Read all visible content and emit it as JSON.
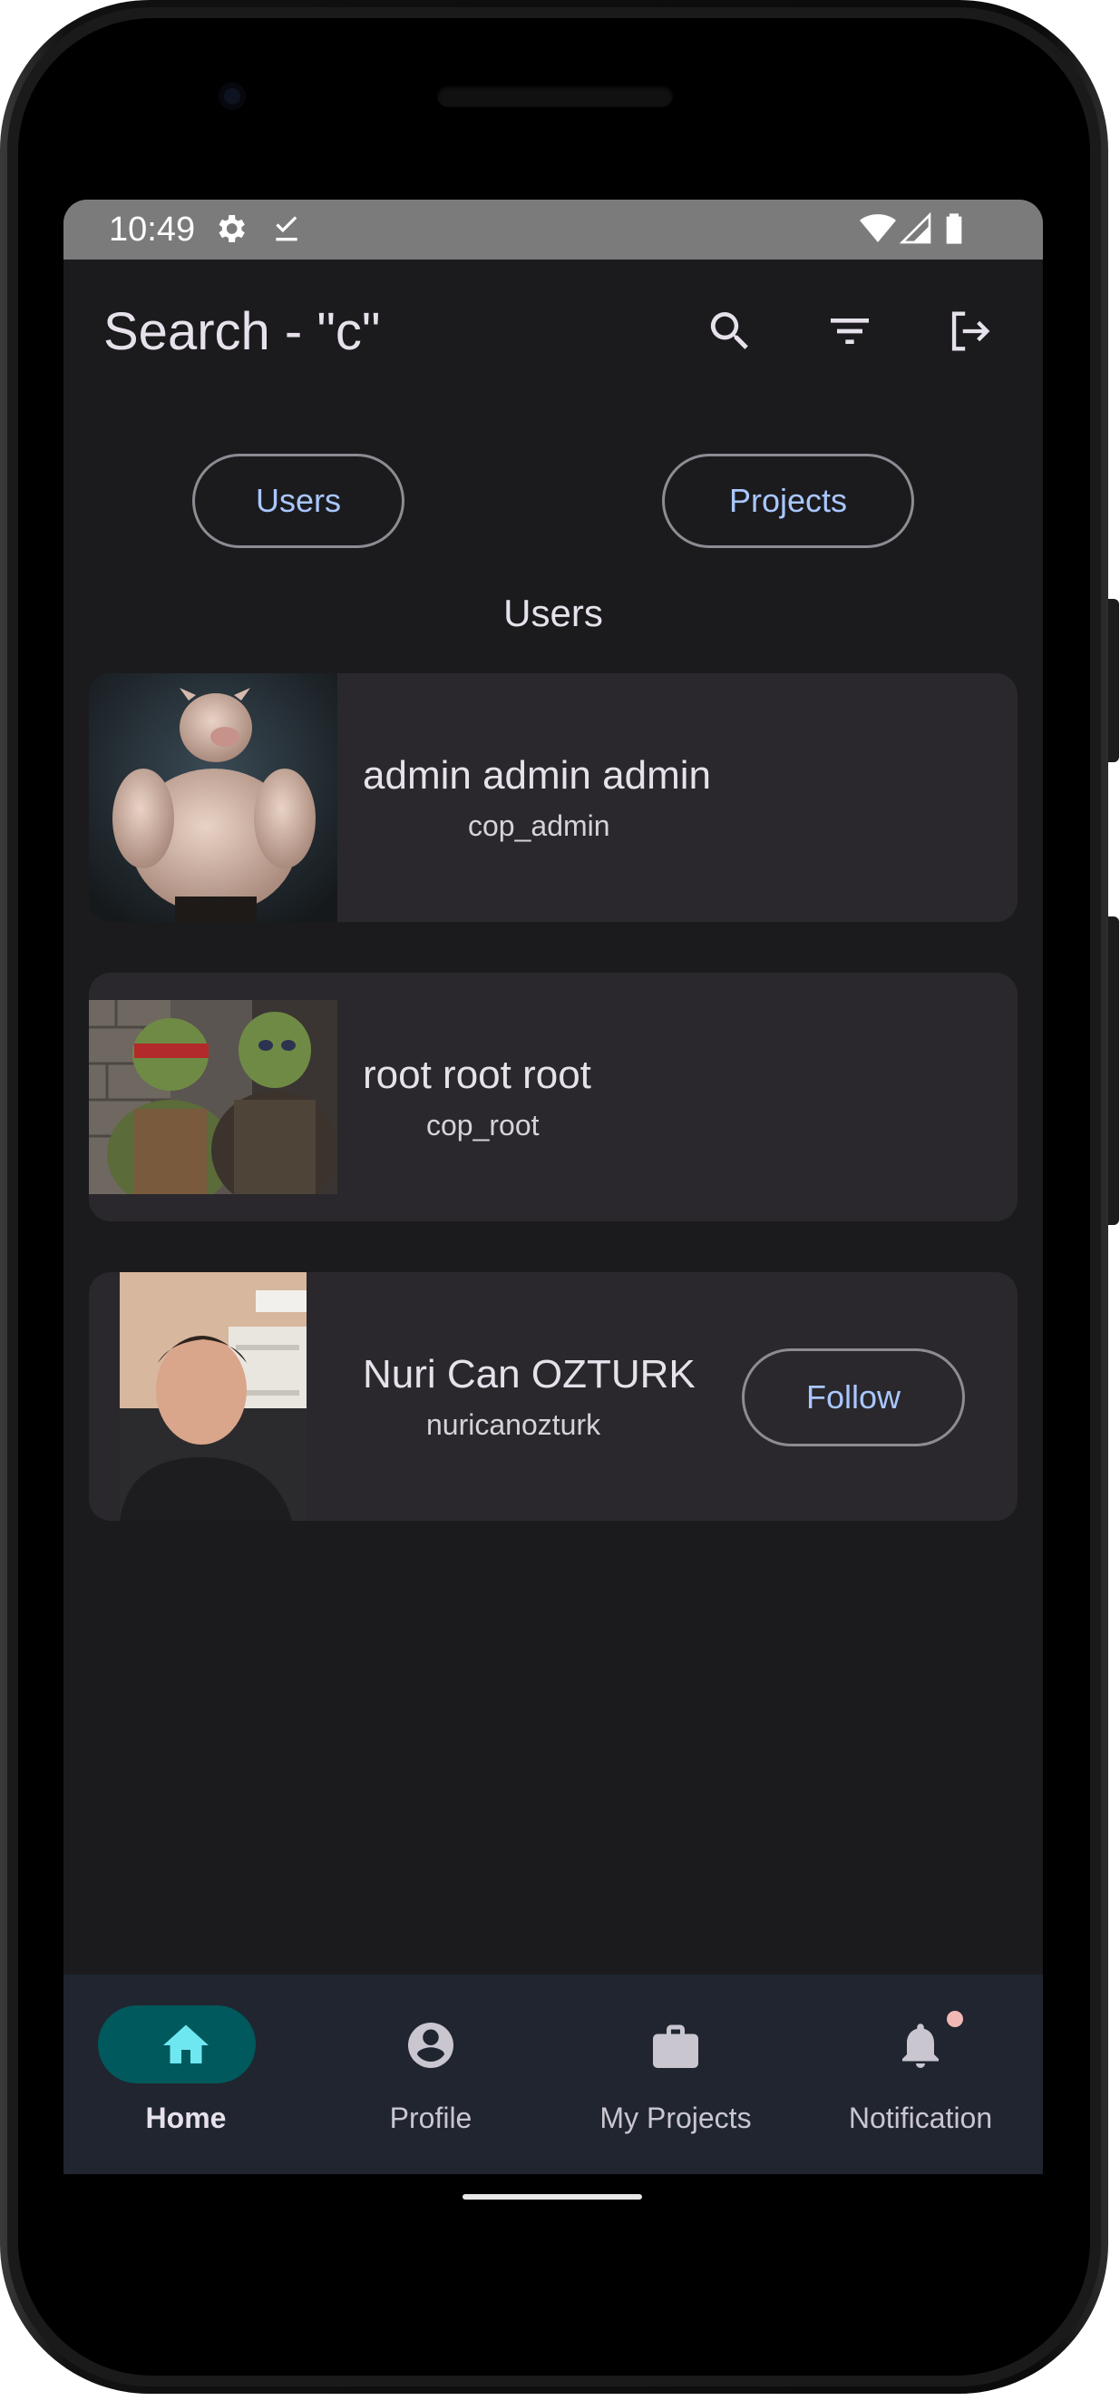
{
  "status_bar": {
    "time": "10:49",
    "icons": [
      "settings-icon",
      "download-done-icon",
      "wifi-icon",
      "signal-icon",
      "battery-icon"
    ]
  },
  "app_bar": {
    "title": "Search - \"c\"",
    "actions": [
      "search-icon",
      "filter-icon",
      "logout-icon"
    ]
  },
  "tabs": [
    {
      "label": "Users"
    },
    {
      "label": "Projects"
    }
  ],
  "section_title": "Users",
  "users": [
    {
      "name": "admin admin admin",
      "username": "cop_admin",
      "photo": "muscular-pig-portrait"
    },
    {
      "name": "root root root",
      "username": "cop_root",
      "photo": "turtle-and-ogre-portrait"
    },
    {
      "name": "Nuri Can OZTURK",
      "username": "nuricanozturk",
      "photo": "man-in-room-portrait",
      "action_label": "Follow"
    }
  ],
  "bottom_nav": [
    {
      "label": "Home",
      "icon": "home-icon",
      "active": true
    },
    {
      "label": "Profile",
      "icon": "account-circle-icon",
      "active": false
    },
    {
      "label": "My Projects",
      "icon": "briefcase-icon",
      "active": false
    },
    {
      "label": "Notification",
      "icon": "bell-icon",
      "active": false,
      "badge": true
    }
  ],
  "colors": {
    "screen_bg": "#1b1b1e",
    "card_bg": "#2a282d",
    "accent_text": "#a9c7ff",
    "nav_bg": "#202530",
    "nav_active": "#00595c",
    "home_icon_active": "#6ee7f0",
    "badge": "#f2b8b5"
  }
}
